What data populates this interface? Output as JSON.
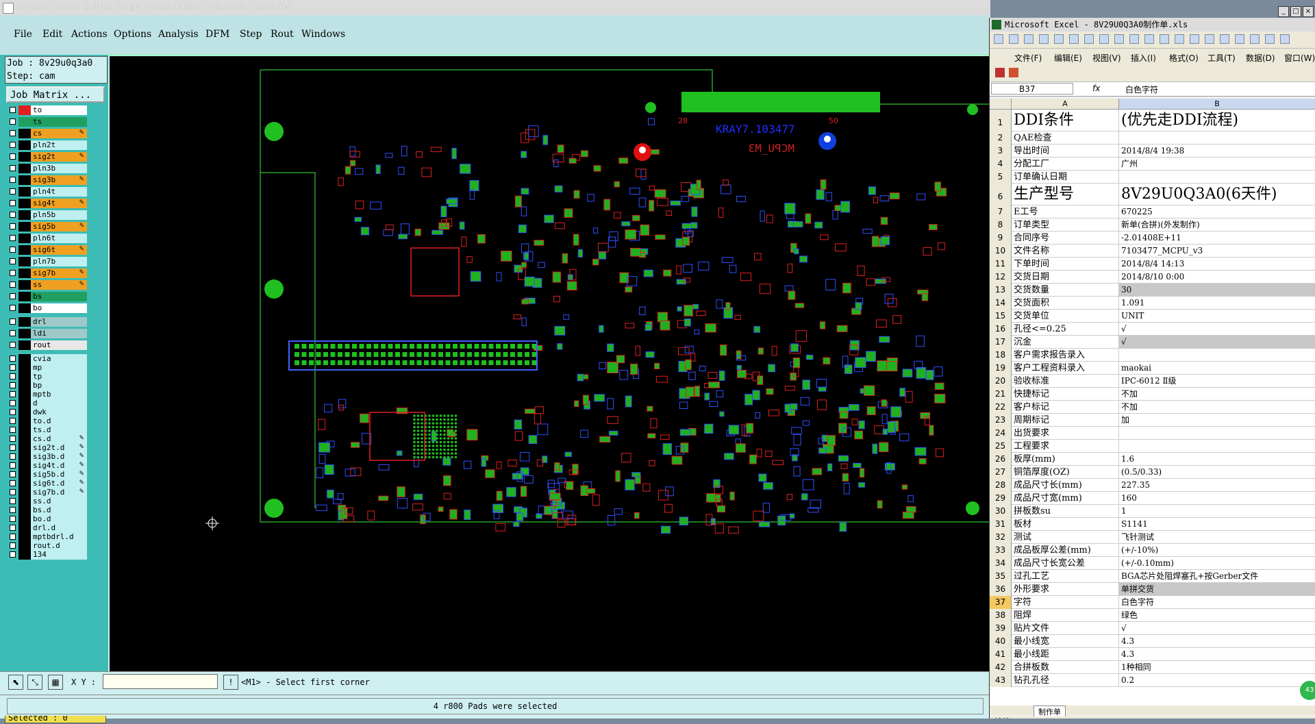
{
  "ge": {
    "title": "Graphic Editor 9.0Tb2 (OO@NT-NTCAM-PC066 - Windows, pid:5160)",
    "menu": [
      "File",
      "Edit",
      "Actions",
      "Options",
      "Analysis",
      "DFM",
      "Step",
      "Rout",
      "Windows"
    ],
    "job": "Job : 8v29u0q3a0",
    "step": "Step: cam",
    "job_matrix": "Job Matrix ...",
    "layers": [
      {
        "name": "to",
        "color": "#ffffff",
        "swatch": "#e02020"
      },
      {
        "name": "ts",
        "color": "#20a060",
        "swatch": "#20a060"
      },
      {
        "name": "cs",
        "color": "#f0a020",
        "edit": true
      },
      {
        "name": "pln2t",
        "color": "#bfeff0"
      },
      {
        "name": "sig2t",
        "color": "#f0a020",
        "edit": true
      },
      {
        "name": "pln3b",
        "color": "#bfeff0"
      },
      {
        "name": "sig3b",
        "color": "#f0a020",
        "edit": true
      },
      {
        "name": "pln4t",
        "color": "#bfeff0"
      },
      {
        "name": "sig4t",
        "color": "#f0a020",
        "edit": true
      },
      {
        "name": "pln5b",
        "color": "#bfeff0"
      },
      {
        "name": "sig5b",
        "color": "#f0a020",
        "edit": true
      },
      {
        "name": "pln6t",
        "color": "#bfeff0"
      },
      {
        "name": "sig6t",
        "color": "#f0a020",
        "edit": true
      },
      {
        "name": "pln7b",
        "color": "#bfeff0"
      },
      {
        "name": "sig7b",
        "color": "#f0a020",
        "edit": true
      },
      {
        "name": "ss",
        "color": "#f0a020",
        "edit": true
      },
      {
        "name": "bs",
        "color": "#20a060"
      },
      {
        "name": "bo",
        "color": "#ffffff"
      },
      {
        "name": "drl",
        "color": "#9fc8c8"
      },
      {
        "name": "ldi",
        "color": "#9fc8c8"
      },
      {
        "name": "rout",
        "color": "#e8e8e8"
      },
      {
        "name": "cvia",
        "color": "#bfeff0"
      },
      {
        "name": "mp",
        "color": "#bfeff0"
      },
      {
        "name": "tp",
        "color": "#bfeff0"
      },
      {
        "name": "bp",
        "color": "#bfeff0"
      },
      {
        "name": "mptb",
        "color": "#bfeff0"
      },
      {
        "name": "d",
        "color": "#bfeff0"
      },
      {
        "name": "dwk",
        "color": "#bfeff0"
      },
      {
        "name": "to.d",
        "color": "#bfeff0"
      },
      {
        "name": "ts.d",
        "color": "#bfeff0"
      },
      {
        "name": "cs.d",
        "color": "#bfeff0",
        "edit": true
      },
      {
        "name": "sig2t.d",
        "color": "#bfeff0",
        "edit": true
      },
      {
        "name": "sig3b.d",
        "color": "#bfeff0",
        "edit": true
      },
      {
        "name": "sig4t.d",
        "color": "#bfeff0",
        "edit": true
      },
      {
        "name": "sig5b.d",
        "color": "#bfeff0",
        "edit": true
      },
      {
        "name": "sig6t.d",
        "color": "#bfeff0",
        "edit": true
      },
      {
        "name": "sig7b.d",
        "color": "#bfeff0",
        "edit": true
      },
      {
        "name": "ss.d",
        "color": "#bfeff0"
      },
      {
        "name": "bs.d",
        "color": "#bfeff0"
      },
      {
        "name": "bo.d",
        "color": "#bfeff0"
      },
      {
        "name": "drl.d",
        "color": "#bfeff0"
      },
      {
        "name": "mptbdrl.d",
        "color": "#bfeff0"
      },
      {
        "name": "rout.d",
        "color": "#bfeff0"
      },
      {
        "name": "134",
        "color": "#bfeff0"
      }
    ],
    "selected": "Selected : 0",
    "xy_label": "X Y :",
    "prompt": "<M1> - Select first corner",
    "status": "4 r800 Pads were selected",
    "pcb_text": {
      "t1": "KRAY7.103477",
      "t2": "MCPU_M3",
      "n28": "28",
      "n50": "50"
    }
  },
  "xl": {
    "title": "Microsoft Excel - 8V29U0Q3A0制作单.xls",
    "menu": [
      "文件(F)",
      "编辑(E)",
      "视图(V)",
      "插入(I)",
      "格式(O)",
      "工具(T)",
      "数据(D)",
      "窗口(W)"
    ],
    "namebox": "B37",
    "fx": "fx",
    "formula": "白色字符",
    "col_a": "A",
    "col_b": "B",
    "rows": [
      {
        "n": "1",
        "a": "DDI条件",
        "b": "(优先走DDI流程)",
        "big": true
      },
      {
        "n": "2",
        "a": "QAE检查",
        "b": ""
      },
      {
        "n": "3",
        "a": "导出时间",
        "b": "2014/8/4 19:38"
      },
      {
        "n": "4",
        "a": "分配工厂",
        "b": "广州"
      },
      {
        "n": "5",
        "a": "订单确认日期",
        "b": ""
      },
      {
        "n": "6",
        "a": "生产型号",
        "b": "8V29U0Q3A0(6天件)",
        "big": true
      },
      {
        "n": "7",
        "a": "E工号",
        "b": "670225"
      },
      {
        "n": "8",
        "a": "订单类型",
        "b": "新单(合拼)(外发制作)"
      },
      {
        "n": "9",
        "a": "合同序号",
        "b": "-2.01408E+11"
      },
      {
        "n": "10",
        "a": "文件名称",
        "b": "7103477_MCPU_v3"
      },
      {
        "n": "11",
        "a": "下单时间",
        "b": "2014/8/4 14:13"
      },
      {
        "n": "12",
        "a": "交货日期",
        "b": "2014/8/10 0:00"
      },
      {
        "n": "13",
        "a": "交货数量",
        "b": "30",
        "gray": true
      },
      {
        "n": "14",
        "a": "交货面积",
        "b": "1.091"
      },
      {
        "n": "15",
        "a": "交货单位",
        "b": "UNIT"
      },
      {
        "n": "16",
        "a": "孔径<=0.25",
        "b": "√"
      },
      {
        "n": "17",
        "a": "沉金",
        "b": "√",
        "gray": true
      },
      {
        "n": "18",
        "a": "客户需求报告录入",
        "b": ""
      },
      {
        "n": "19",
        "a": "客户工程资料录入",
        "b": "maokai"
      },
      {
        "n": "20",
        "a": "验收标准",
        "b": "IPC-6012 Ⅱ级"
      },
      {
        "n": "21",
        "a": "快捷标记",
        "b": "不加"
      },
      {
        "n": "22",
        "a": "客户标记",
        "b": "不加"
      },
      {
        "n": "23",
        "a": "周期标记",
        "b": "加"
      },
      {
        "n": "24",
        "a": "出货要求",
        "b": ""
      },
      {
        "n": "25",
        "a": "工程要求",
        "b": ""
      },
      {
        "n": "26",
        "a": "板厚(mm)",
        "b": "1.6"
      },
      {
        "n": "27",
        "a": "铜箔厚度(OZ)",
        "b": "(0.5/0.33)"
      },
      {
        "n": "28",
        "a": "成品尺寸长(mm)",
        "b": "227.35"
      },
      {
        "n": "29",
        "a": "成品尺寸宽(mm)",
        "b": "160"
      },
      {
        "n": "30",
        "a": "拼板数su",
        "b": "1"
      },
      {
        "n": "31",
        "a": "板材",
        "b": "S1141"
      },
      {
        "n": "32",
        "a": "测试",
        "b": "飞针测试"
      },
      {
        "n": "33",
        "a": "成品板厚公差(mm)",
        "b": "(+/-10%)"
      },
      {
        "n": "34",
        "a": "成品尺寸长宽公差",
        "b": "(+/-0.10mm)"
      },
      {
        "n": "35",
        "a": "过孔工艺",
        "b": "BGA芯片处阻焊塞孔+按Gerber文件"
      },
      {
        "n": "36",
        "a": "外形要求",
        "b": "单拼交货",
        "gray": true
      },
      {
        "n": "37",
        "a": "字符",
        "b": "白色字符",
        "sel": true
      },
      {
        "n": "38",
        "a": "阻焊",
        "b": "绿色"
      },
      {
        "n": "39",
        "a": "贴片文件",
        "b": "√"
      },
      {
        "n": "40",
        "a": "最小线宽",
        "b": "4.3"
      },
      {
        "n": "41",
        "a": "最小线距",
        "b": "4.3"
      },
      {
        "n": "42",
        "a": "合拼板数",
        "b": "1种相同"
      },
      {
        "n": "43",
        "a": "钻孔孔径",
        "b": "0.2"
      }
    ],
    "sheet_tab": "制作单",
    "status": "就绪",
    "badge": "43"
  }
}
